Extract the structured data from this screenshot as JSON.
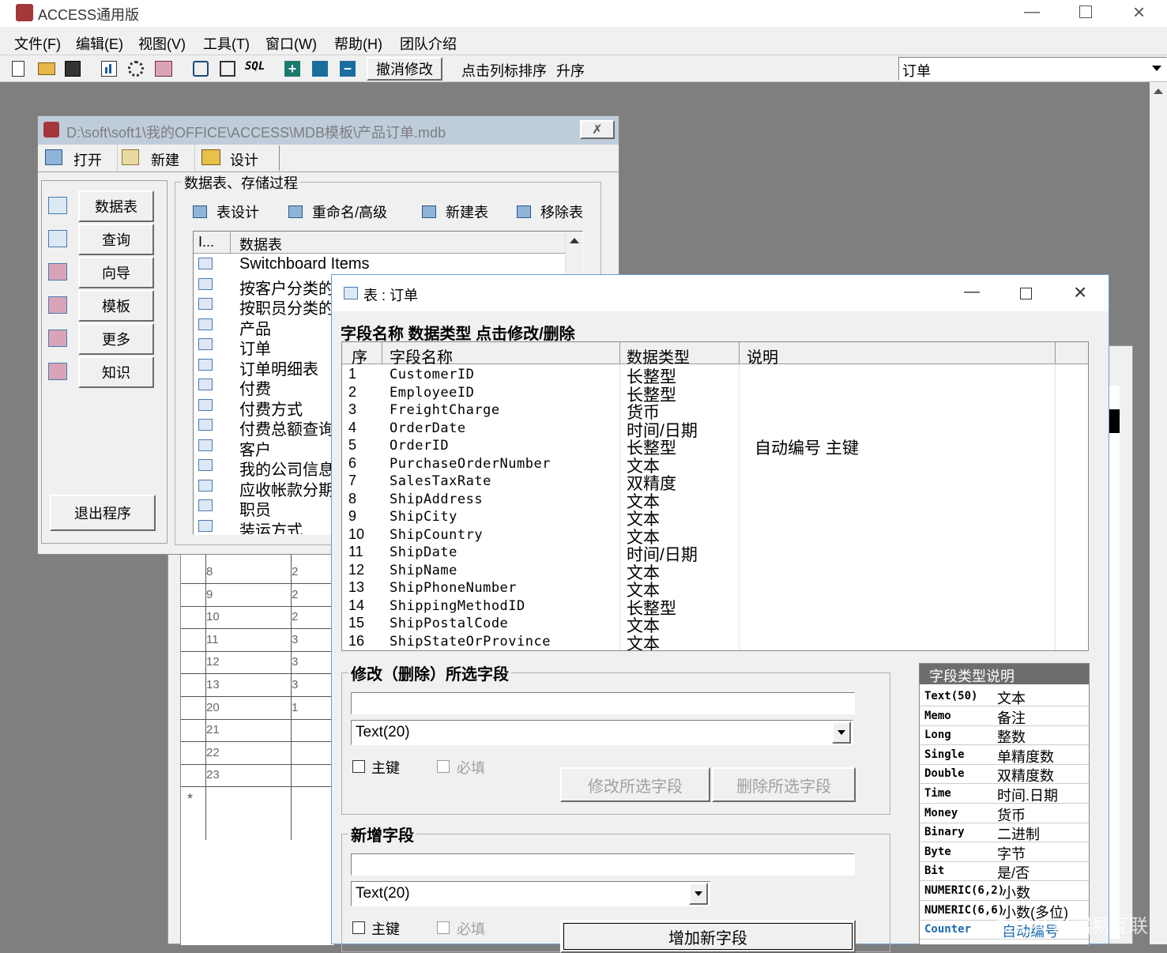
{
  "app": {
    "title": "ACCESS通用版"
  },
  "menu": [
    "文件(F)",
    "编辑(E)",
    "视图(V)",
    "工具(T)",
    "窗口(W)",
    "帮助(H)",
    "团队介绍"
  ],
  "toolbar": {
    "undo_label": "撤消修改",
    "sort_hint": "点击列标排序",
    "sort_order": "升序",
    "table_select": "订单"
  },
  "db_window": {
    "title": "D:\\soft\\soft1\\我的OFFICE\\ACCESS\\MDB模板\\产品订单.mdb",
    "tabs": [
      "打开",
      "新建",
      "设计"
    ],
    "categories": [
      "数据表",
      "查询",
      "向导",
      "模板",
      "更多",
      "知识"
    ],
    "exit_label": "退出程序",
    "group_title": "数据表、存储过程",
    "actions": [
      "表设计",
      "重命名/高级",
      "新建表",
      "移除表"
    ],
    "list_headers": [
      "I...",
      "数据表"
    ],
    "tables": [
      "Switchboard Items",
      "按客户分类的",
      "按职员分类的",
      "产品",
      "订单",
      "订单明细表",
      "付费",
      "付费方式",
      "付费总额查询",
      "客户",
      "我的公司信息",
      "应收帐款分期",
      "职员",
      "装运方式"
    ]
  },
  "back_grid": {
    "rows": [
      [
        "8",
        "2"
      ],
      [
        "9",
        "2"
      ],
      [
        "10",
        "2"
      ],
      [
        "11",
        "3"
      ],
      [
        "12",
        "3"
      ],
      [
        "13",
        "3"
      ],
      [
        "20",
        "1"
      ],
      [
        "21",
        ""
      ],
      [
        "22",
        ""
      ],
      [
        "23",
        ""
      ]
    ],
    "new_row_marker": "*"
  },
  "table_window": {
    "title": "表 : 订单",
    "section_title": "字段名称 数据类型  点击修改/删除",
    "headers": [
      "序",
      "字段名称",
      "数据类型",
      "说明"
    ],
    "fields": [
      {
        "n": "1",
        "name": "CustomerID",
        "type": "长整型",
        "desc": ""
      },
      {
        "n": "2",
        "name": "EmployeeID",
        "type": "长整型",
        "desc": ""
      },
      {
        "n": "3",
        "name": "FreightCharge",
        "type": "货币",
        "desc": ""
      },
      {
        "n": "4",
        "name": "OrderDate",
        "type": "时间/日期",
        "desc": ""
      },
      {
        "n": "5",
        "name": "OrderID",
        "type": "长整型",
        "desc": "自动编号 主键"
      },
      {
        "n": "6",
        "name": "PurchaseOrderNumber",
        "type": "文本",
        "desc": ""
      },
      {
        "n": "7",
        "name": "SalesTaxRate",
        "type": "双精度",
        "desc": ""
      },
      {
        "n": "8",
        "name": "ShipAddress",
        "type": "文本",
        "desc": ""
      },
      {
        "n": "9",
        "name": "ShipCity",
        "type": "文本",
        "desc": ""
      },
      {
        "n": "10",
        "name": "ShipCountry",
        "type": "文本",
        "desc": ""
      },
      {
        "n": "11",
        "name": "ShipDate",
        "type": "时间/日期",
        "desc": ""
      },
      {
        "n": "12",
        "name": "ShipName",
        "type": "文本",
        "desc": ""
      },
      {
        "n": "13",
        "name": "ShipPhoneNumber",
        "type": "文本",
        "desc": ""
      },
      {
        "n": "14",
        "name": "ShippingMethodID",
        "type": "长整型",
        "desc": ""
      },
      {
        "n": "15",
        "name": "ShipPostalCode",
        "type": "文本",
        "desc": ""
      },
      {
        "n": "16",
        "name": "ShipStateOrProvince",
        "type": "文本",
        "desc": ""
      }
    ],
    "modify": {
      "legend": "修改（删除）所选字段",
      "name_value": "",
      "type_value": "Text(20)",
      "pk_label": "主键",
      "required_label": "必填",
      "modify_btn": "修改所选字段",
      "delete_btn": "删除所选字段"
    },
    "add": {
      "legend": "新增字段",
      "name_value": "",
      "type_value": "Text(20)",
      "pk_label": "主键",
      "required_label": "必填",
      "add_btn": "增加新字段"
    },
    "type_help": {
      "title": "字段类型说明",
      "items": [
        [
          "Text(50)",
          "文本"
        ],
        [
          "Memo",
          "备注"
        ],
        [
          "Long",
          "整数"
        ],
        [
          "Single",
          "单精度数"
        ],
        [
          "Double",
          "双精度数"
        ],
        [
          "Time",
          "时间.日期"
        ],
        [
          "Money",
          "货币"
        ],
        [
          "Binary",
          "二进制"
        ],
        [
          "Byte",
          "字节"
        ],
        [
          "Bit",
          "是/否"
        ],
        [
          "NUMERIC(6,2)",
          "小数"
        ],
        [
          "NUMERIC(6,6)",
          "小数(多位)"
        ],
        [
          "Counter",
          "自动编号"
        ]
      ]
    }
  },
  "watermark": "CSDN @瑞易互联",
  "colors": {
    "mdi_bg": "#7f7f7f",
    "window_bg": "#f0f0f0",
    "inactive_title": "#bfcddb",
    "help_header": "#6d6d6d"
  }
}
